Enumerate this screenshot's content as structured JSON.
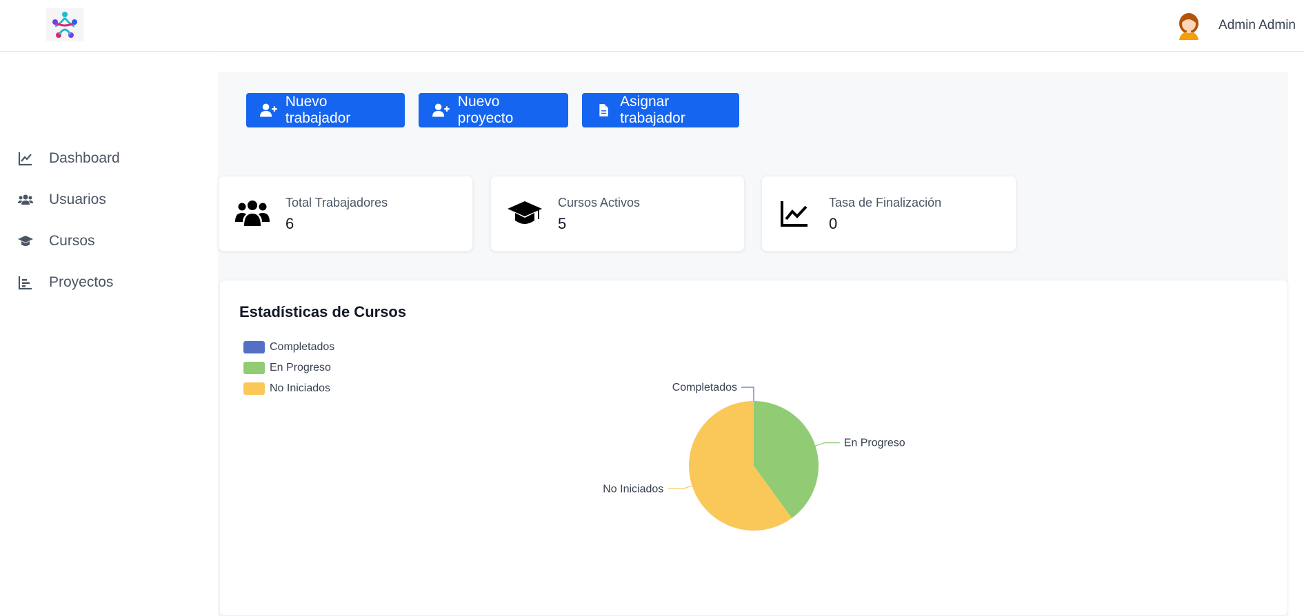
{
  "header": {
    "user_name": "Admin Admin"
  },
  "sidebar": {
    "items": [
      {
        "label": "Dashboard",
        "icon": "chart-line-icon"
      },
      {
        "label": "Usuarios",
        "icon": "users-icon"
      },
      {
        "label": "Cursos",
        "icon": "graduation-cap-icon"
      },
      {
        "label": "Proyectos",
        "icon": "bar-chart-icon"
      }
    ]
  },
  "actions": [
    {
      "label": "Nuevo trabajador",
      "icon": "user-plus-icon"
    },
    {
      "label": "Nuevo proyecto",
      "icon": "user-plus-icon"
    },
    {
      "label": "Asignar trabajador",
      "icon": "file-icon"
    }
  ],
  "stats": [
    {
      "label": "Total Trabajadores",
      "value": "6",
      "icon": "users-icon"
    },
    {
      "label": "Cursos Activos",
      "value": "5",
      "icon": "graduation-cap-icon"
    },
    {
      "label": "Tasa de Finalización",
      "value": "0",
      "icon": "chart-line-icon"
    }
  ],
  "panel": {
    "title": "Estadísticas de Cursos"
  },
  "colors": {
    "primary": "#1565f0",
    "completados": "#5470c6",
    "en_progreso": "#91cc75",
    "no_iniciados": "#fac858"
  },
  "chart_data": {
    "type": "pie",
    "title": "Estadísticas de Cursos",
    "legend": "top-left",
    "categories": [
      "Completados",
      "En Progreso",
      "No Iniciados"
    ],
    "values": [
      0,
      2,
      3
    ],
    "colors": [
      "#5470c6",
      "#91cc75",
      "#fac858"
    ]
  }
}
